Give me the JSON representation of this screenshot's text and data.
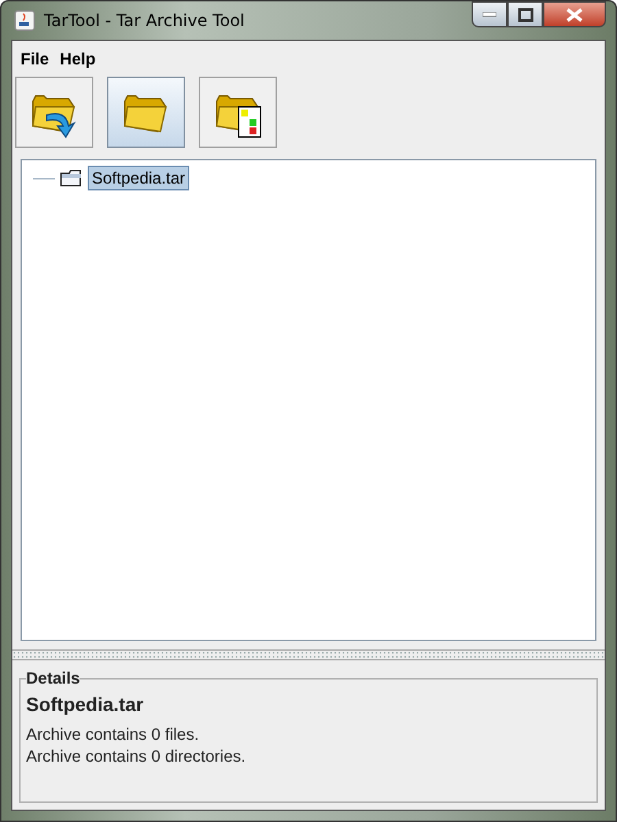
{
  "window": {
    "title": "TarTool - Tar Archive Tool"
  },
  "menu": [
    {
      "label": "File"
    },
    {
      "label": "Help"
    }
  ],
  "toolbar": [
    {
      "kind": "extract",
      "selected": false
    },
    {
      "kind": "open",
      "selected": true
    },
    {
      "kind": "tree",
      "selected": false
    }
  ],
  "tree": {
    "items": [
      {
        "label": "Softpedia.tar",
        "selected": true
      }
    ]
  },
  "details": {
    "title": "Details",
    "name": "Softpedia.tar",
    "lines": [
      "Archive contains 0 files.",
      "Archive contains 0 directories."
    ]
  }
}
